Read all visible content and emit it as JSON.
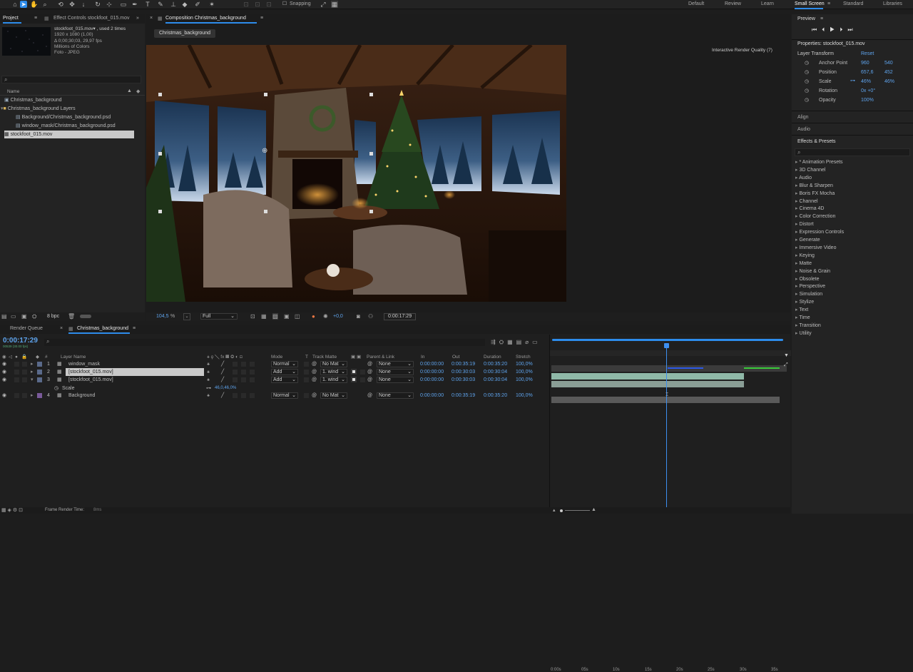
{
  "topbar": {
    "snapping": "Snapping",
    "workspaces": [
      "Default",
      "Review",
      "Learn",
      "Small Screen",
      "Standard",
      "Libraries"
    ],
    "active_workspace": "Small Screen"
  },
  "project": {
    "tab": "Project",
    "effect_controls_tab": "Effect Controls stockfoot_015.mov",
    "info": [
      "stockfoot_015.mov▾ , used 2 times",
      "1920 x 1080 (1,00)",
      "Δ 0;00;30;03, 29,97 fps",
      "Millions of Colors",
      "Foto - JPEG"
    ],
    "search_placeholder": "",
    "col_name": "Name",
    "items": [
      {
        "label": "Christmas_background",
        "indent": 0
      },
      {
        "label": "Christmas_background Layers",
        "indent": 0
      },
      {
        "label": "Background/Christmas_background.psd",
        "indent": 2
      },
      {
        "label": "window_mask/Christmas_background.psd",
        "indent": 2
      },
      {
        "label": "stockfoot_015.mov",
        "indent": 0
      }
    ],
    "bpc": "8 bpc"
  },
  "composition": {
    "tab": "Composition Christmas_background",
    "chip": "Christmas_background",
    "render_quality": "Interactive Render Quality (7)",
    "zoom": "104,5",
    "zoom_unit": "%",
    "resolution": "Full",
    "exposure": "+0,0",
    "timecode": "0:00:17:29"
  },
  "preview": {
    "title": "Preview",
    "properties_title": "Properties: stockfoot_015.mov",
    "layer_transform": "Layer Transform",
    "reset": "Reset",
    "props": [
      {
        "name": "Anchor Point",
        "v1": "960",
        "v2": "540"
      },
      {
        "name": "Position",
        "v1": "657,6",
        "v2": "452"
      },
      {
        "name": "Scale",
        "v1": "46%",
        "v2": "46%"
      },
      {
        "name": "Rotation",
        "v1": "0x +0°",
        "v2": ""
      },
      {
        "name": "Opacity",
        "v1": "100%",
        "v2": ""
      }
    ],
    "align": "Align",
    "audio": "Audio",
    "effects_title": "Effects & Presets",
    "effects": [
      "* Animation Presets",
      "3D Channel",
      "Audio",
      "Blur & Sharpen",
      "Boris FX Mocha",
      "Channel",
      "Cinema 4D",
      "Color Correction",
      "Distort",
      "Expression Controls",
      "Generate",
      "Immersive Video",
      "Keying",
      "Matte",
      "Noise & Grain",
      "Obsolete",
      "Perspective",
      "Simulation",
      "Stylize",
      "Text",
      "Time",
      "Transition",
      "Utility"
    ]
  },
  "timeline": {
    "tab_render": "Render Queue",
    "tab_comp": "Christmas_background",
    "timecode": "0:00:17:29",
    "subtime": "00539 (30.00 fps)",
    "headers": {
      "layer_name": "Layer Name",
      "mode": "Mode",
      "t": "T",
      "track_matte": "Track Matte",
      "parent": "Parent & Link",
      "in": "In",
      "out": "Out",
      "duration": "Duration",
      "stretch": "Stretch"
    },
    "layers": [
      {
        "num": "1",
        "name": "window_mask",
        "mode": "Normal",
        "matte": "No Mat",
        "parent": "None",
        "in": "0:00:00:00",
        "out": "0:00:35:19",
        "dur": "0:00:35:20",
        "stretch": "100,0%",
        "selected": false
      },
      {
        "num": "2",
        "name": "[stockfoot_015.mov]",
        "mode": "Add",
        "matte": "1. wind",
        "parent": "None",
        "in": "0:00:00:00",
        "out": "0:00:30:03",
        "dur": "0:00:30:04",
        "stretch": "100,0%",
        "selected": true
      },
      {
        "num": "3",
        "name": "[stockfoot_015.mov]",
        "mode": "Add",
        "matte": "1. wind",
        "parent": "None",
        "in": "0:00:00:00",
        "out": "0:00:30:03",
        "dur": "0:00:30:04",
        "stretch": "100,0%",
        "selected": false
      },
      {
        "num": "4",
        "name": "Background",
        "mode": "Normal",
        "matte": "No Mat",
        "parent": "None",
        "in": "0:00:00:00",
        "out": "0:00:35:19",
        "dur": "0:00:35:20",
        "stretch": "100,0%",
        "selected": false
      }
    ],
    "scale_prop": "Scale",
    "scale_value": "46,0,46,0%",
    "ruler": [
      "0:00s",
      "05s",
      "10s",
      "15s",
      "20s",
      "25s",
      "30s",
      "35s"
    ],
    "footer": "Frame Render Time:",
    "footer_value": "8ms"
  },
  "colors": {
    "accent": "#2d8ceb",
    "layer_bar": "#8fb9a8",
    "selected_row": "#c9c9c9"
  }
}
